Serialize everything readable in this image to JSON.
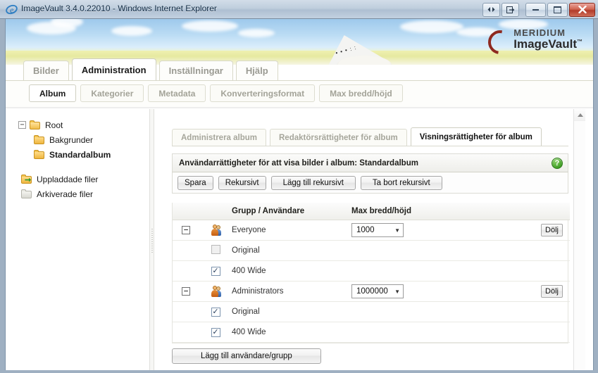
{
  "window": {
    "title": "ImageVault 3.4.0.22010 - Windows Internet Explorer",
    "app_icon": "internet-explorer-icon",
    "controls": {
      "tab_list_label": "◀▶",
      "quick_tabs_label": "❐",
      "minimize_label": "–",
      "maximize_label": "□",
      "close_label": "✕"
    }
  },
  "branding": {
    "company": "MERIDIUM",
    "product": "ImageVault",
    "trademark": "™",
    "accent_color": "#8e2a20"
  },
  "main_tabs": [
    {
      "label": "Bilder",
      "active": false
    },
    {
      "label": "Administration",
      "active": true
    },
    {
      "label": "Inställningar",
      "active": false
    },
    {
      "label": "Hjälp",
      "active": false
    }
  ],
  "sub_tabs": [
    {
      "label": "Album",
      "active": true
    },
    {
      "label": "Kategorier",
      "active": false
    },
    {
      "label": "Metadata",
      "active": false
    },
    {
      "label": "Konverteringsformat",
      "active": false
    },
    {
      "label": "Max bredd/höjd",
      "active": false
    }
  ],
  "tree": {
    "root": {
      "label": "Root",
      "expander": "−",
      "icon": "folder-open-icon"
    },
    "children": [
      {
        "label": "Bakgrunder",
        "icon": "folder-icon",
        "selected": false
      },
      {
        "label": "Standardalbum",
        "icon": "folder-icon",
        "selected": true
      }
    ],
    "extras": [
      {
        "label": "Uppladdade filer",
        "icon": "folder-upload-icon"
      },
      {
        "label": "Arkiverade filer",
        "icon": "folder-archive-icon"
      }
    ]
  },
  "content_tabs": [
    {
      "label": "Administrera album",
      "active": false
    },
    {
      "label": "Redaktörsrättigheter för album",
      "active": false
    },
    {
      "label": "Visningsrättigheter för album",
      "active": true
    }
  ],
  "panel": {
    "title": "Användarrättigheter för att visa bilder i album: Standardalbum",
    "help_icon": "help-question-icon",
    "help_glyph": "?",
    "toolbar": [
      {
        "label": "Spara"
      },
      {
        "label": "Rekursivt"
      },
      {
        "label": "Lägg till rekursivt"
      },
      {
        "label": "Ta bort rekursivt"
      }
    ]
  },
  "table": {
    "columns": [
      "",
      "",
      "Grupp / Användare",
      "Max bredd/höjd",
      ""
    ],
    "header_group": "Grupp / Användare",
    "header_size": "Max bredd/höjd",
    "rows": [
      {
        "type": "group",
        "expander": "−",
        "icon": "group-users-icon",
        "name": "Everyone",
        "size_value": "1000",
        "action_label": "Dölj"
      },
      {
        "type": "format",
        "checked": false,
        "disabled": true,
        "check_glyph": "",
        "name": "Original"
      },
      {
        "type": "format",
        "checked": true,
        "disabled": false,
        "check_glyph": "✓",
        "name": "400 Wide"
      },
      {
        "type": "group",
        "expander": "−",
        "icon": "group-users-icon",
        "name": "Administrators",
        "size_value": "1000000",
        "action_label": "Dölj"
      },
      {
        "type": "format",
        "checked": true,
        "disabled": false,
        "check_glyph": "✓",
        "name": "Original"
      },
      {
        "type": "format",
        "checked": true,
        "disabled": false,
        "check_glyph": "✓",
        "name": "400 Wide"
      }
    ],
    "dropdown_arrow": "▼"
  },
  "footer": {
    "add_button": "Lägg till användare/grupp"
  }
}
